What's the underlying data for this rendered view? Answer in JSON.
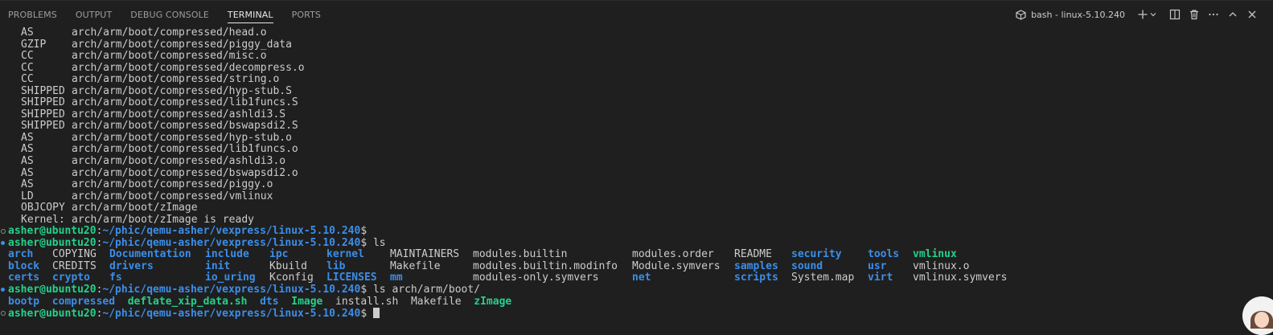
{
  "panel": {
    "tabs": [
      {
        "label": "PROBLEMS"
      },
      {
        "label": "OUTPUT"
      },
      {
        "label": "DEBUG CONSOLE"
      },
      {
        "label": "TERMINAL"
      },
      {
        "label": "PORTS"
      }
    ],
    "active_tab": "TERMINAL",
    "terminal_name": "bash - linux-5.10.240"
  },
  "build_output": [
    {
      "tag": "AS",
      "path": "arch/arm/boot/compressed/head.o"
    },
    {
      "tag": "GZIP",
      "path": "arch/arm/boot/compressed/piggy_data"
    },
    {
      "tag": "CC",
      "path": "arch/arm/boot/compressed/misc.o"
    },
    {
      "tag": "CC",
      "path": "arch/arm/boot/compressed/decompress.o"
    },
    {
      "tag": "CC",
      "path": "arch/arm/boot/compressed/string.o"
    },
    {
      "tag": "SHIPPED",
      "path": "arch/arm/boot/compressed/hyp-stub.S"
    },
    {
      "tag": "SHIPPED",
      "path": "arch/arm/boot/compressed/lib1funcs.S"
    },
    {
      "tag": "SHIPPED",
      "path": "arch/arm/boot/compressed/ashldi3.S"
    },
    {
      "tag": "SHIPPED",
      "path": "arch/arm/boot/compressed/bswapsdi2.S"
    },
    {
      "tag": "AS",
      "path": "arch/arm/boot/compressed/hyp-stub.o"
    },
    {
      "tag": "AS",
      "path": "arch/arm/boot/compressed/lib1funcs.o"
    },
    {
      "tag": "AS",
      "path": "arch/arm/boot/compressed/ashldi3.o"
    },
    {
      "tag": "AS",
      "path": "arch/arm/boot/compressed/bswapsdi2.o"
    },
    {
      "tag": "AS",
      "path": "arch/arm/boot/compressed/piggy.o"
    },
    {
      "tag": "LD",
      "path": "arch/arm/boot/compressed/vmlinux"
    },
    {
      "tag": "OBJCOPY",
      "path": "arch/arm/boot/zImage"
    },
    {
      "tag": "Kernel:",
      "path": "arch/arm/boot/zImage is ready"
    }
  ],
  "prompt": {
    "user_host": "asher@ubuntu20",
    "colon": ":",
    "cwd": "~/phic/qemu-asher/vexpress/linux-5.10.240",
    "dollar": "$"
  },
  "commands": {
    "ls": " ls",
    "ls_boot": " ls arch/arm/boot/"
  },
  "ls_rows": [
    [
      {
        "name": "arch",
        "type": "dir"
      },
      {
        "name": "COPYING",
        "type": "file"
      },
      {
        "name": "Documentation",
        "type": "dir"
      },
      {
        "name": "include",
        "type": "dir"
      },
      {
        "name": "ipc",
        "type": "dir"
      },
      {
        "name": "kernel",
        "type": "dir"
      },
      {
        "name": "MAINTAINERS",
        "type": "file"
      },
      {
        "name": "modules.builtin",
        "type": "file"
      },
      {
        "name": "modules.order",
        "type": "file"
      },
      {
        "name": "README",
        "type": "file"
      },
      {
        "name": "security",
        "type": "dir"
      },
      {
        "name": "tools",
        "type": "dir"
      },
      {
        "name": "vmlinux",
        "type": "exec"
      }
    ],
    [
      {
        "name": "block",
        "type": "dir"
      },
      {
        "name": "CREDITS",
        "type": "file"
      },
      {
        "name": "drivers",
        "type": "dir"
      },
      {
        "name": "init",
        "type": "dir"
      },
      {
        "name": "Kbuild",
        "type": "file"
      },
      {
        "name": "lib",
        "type": "dir"
      },
      {
        "name": "Makefile",
        "type": "file"
      },
      {
        "name": "modules.builtin.modinfo",
        "type": "file"
      },
      {
        "name": "Module.symvers",
        "type": "file"
      },
      {
        "name": "samples",
        "type": "dir"
      },
      {
        "name": "sound",
        "type": "dir"
      },
      {
        "name": "usr",
        "type": "dir"
      },
      {
        "name": "vmlinux.o",
        "type": "file"
      }
    ],
    [
      {
        "name": "certs",
        "type": "dir"
      },
      {
        "name": "crypto",
        "type": "dir"
      },
      {
        "name": "fs",
        "type": "dir"
      },
      {
        "name": "io_uring",
        "type": "dir"
      },
      {
        "name": "Kconfig",
        "type": "file"
      },
      {
        "name": "LICENSES",
        "type": "dir"
      },
      {
        "name": "mm",
        "type": "dir"
      },
      {
        "name": "modules-only.symvers",
        "type": "file"
      },
      {
        "name": "net",
        "type": "dir"
      },
      {
        "name": "scripts",
        "type": "dir"
      },
      {
        "name": "System.map",
        "type": "file"
      },
      {
        "name": "virt",
        "type": "dir"
      },
      {
        "name": "vmlinux.symvers",
        "type": "file"
      }
    ]
  ],
  "ls_boot": [
    {
      "name": "bootp",
      "type": "dir"
    },
    {
      "name": "compressed",
      "type": "dir"
    },
    {
      "name": "deflate_xip_data.sh",
      "type": "exec"
    },
    {
      "name": "dts",
      "type": "dir"
    },
    {
      "name": "Image",
      "type": "exec"
    },
    {
      "name": "install.sh",
      "type": "file"
    },
    {
      "name": "Makefile",
      "type": "file"
    },
    {
      "name": "zImage",
      "type": "exec"
    }
  ],
  "colors": {
    "background": "#1f1f1f",
    "prompt_green": "#23d18b",
    "dir_blue": "#3b8eea",
    "text": "#cccccc"
  }
}
